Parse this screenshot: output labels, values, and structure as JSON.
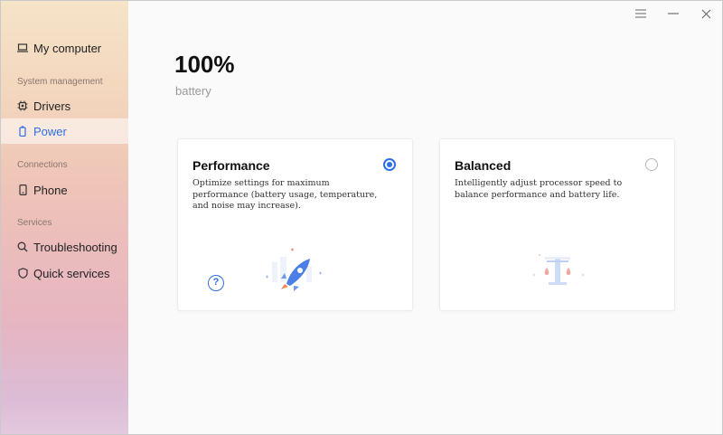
{
  "sidebar": {
    "my_computer": "My computer",
    "system_management": "System management",
    "drivers": "Drivers",
    "power": "Power",
    "connections": "Connections",
    "phone": "Phone",
    "services": "Services",
    "troubleshooting": "Troubleshooting",
    "quick_services": "Quick services"
  },
  "battery": {
    "value": "100%",
    "label": "battery"
  },
  "modes": {
    "performance": {
      "title": "Performance",
      "description": "Optimize settings for maximum performance (battery usage, temperature, and noise may increase).",
      "selected": true,
      "help": "?"
    },
    "balanced": {
      "title": "Balanced",
      "description": "Intelligently adjust processor speed to balance performance and battery life.",
      "selected": false
    }
  },
  "colors": {
    "accent": "#2f6fe4"
  },
  "icons": {
    "window": [
      "menu-icon",
      "minimize-icon",
      "close-icon"
    ],
    "nav": [
      "laptop-icon",
      "chip-icon",
      "battery-icon",
      "phone-icon",
      "search-icon",
      "shield-icon"
    ]
  }
}
